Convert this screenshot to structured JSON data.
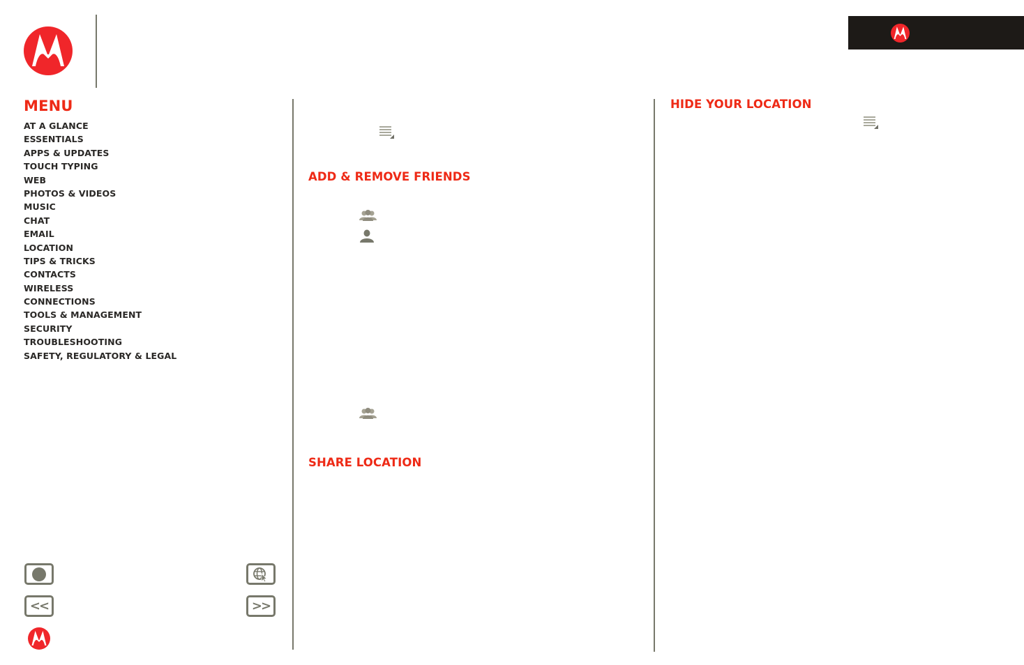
{
  "header": {
    "logo_icon": "motorola-logo-icon",
    "brand_bar_icon": "motorola-logo-icon"
  },
  "sidebar": {
    "title": "MENU",
    "items": [
      {
        "label": "AT A GLANCE"
      },
      {
        "label": "ESSENTIALS"
      },
      {
        "label": "APPS & UPDATES"
      },
      {
        "label": "TOUCH TYPING"
      },
      {
        "label": "WEB"
      },
      {
        "label": "PHOTOS & VIDEOS"
      },
      {
        "label": "MUSIC"
      },
      {
        "label": "CHAT"
      },
      {
        "label": "EMAIL"
      },
      {
        "label": "LOCATION"
      },
      {
        "label": "TIPS & TRICKS"
      },
      {
        "label": "CONTACTS"
      },
      {
        "label": "WIRELESS"
      },
      {
        "label": "CONNECTIONS"
      },
      {
        "label": "TOOLS & MANAGEMENT"
      },
      {
        "label": "SECURITY"
      },
      {
        "label": "TROUBLESHOOTING"
      },
      {
        "label": "SAFETY, REGULATORY & LEGAL"
      }
    ],
    "nav_buttons": {
      "home_icon": "home-icon",
      "web_icon": "globe-cursor-icon",
      "back_label": "<<",
      "forward_label": ">>"
    },
    "footer_icon": "motorola-logo-icon"
  },
  "content": {
    "sections": [
      {
        "heading": "ADD & REMOVE FRIENDS"
      },
      {
        "heading": "SHARE LOCATION"
      },
      {
        "heading": "HIDE YOUR LOCATION"
      }
    ],
    "icons": {
      "menu": "menu-key-icon",
      "friends": "friends-icon",
      "person": "person-icon"
    }
  },
  "colors": {
    "accent": "#ee2a16",
    "logo_red": "#f0262a",
    "divider": "#77786b",
    "brand_bar": "#1d1a17",
    "menu_text": "#2a2826"
  }
}
